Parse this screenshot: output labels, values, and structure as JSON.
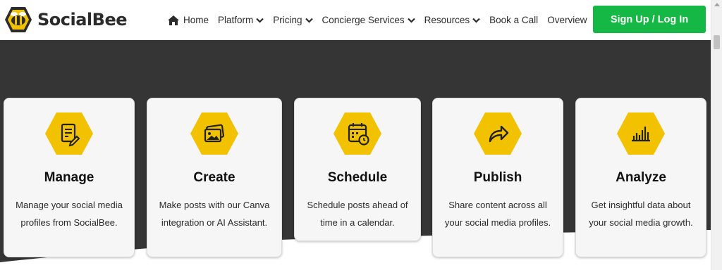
{
  "brand": {
    "name": "SocialBee"
  },
  "nav": {
    "home": "Home",
    "platform": "Platform",
    "pricing": "Pricing",
    "concierge": "Concierge Services",
    "resources": "Resources",
    "book": "Book a Call",
    "overview": "Overview"
  },
  "cta": {
    "signup": "Sign Up / Log In"
  },
  "colors": {
    "accent_green": "#16b845",
    "hex_yellow": "#f2c200",
    "hero_dark": "#353535"
  },
  "cards": [
    {
      "title": "Manage",
      "desc": "Manage your social media profiles from SocialBee.",
      "icon": "document-edit-icon"
    },
    {
      "title": "Create",
      "desc": "Make posts with our Canva integration or AI Assistant.",
      "icon": "images-icon"
    },
    {
      "title": "Schedule",
      "desc": "Schedule posts ahead of time in a calendar.",
      "icon": "calendar-clock-icon"
    },
    {
      "title": "Publish",
      "desc": "Share content across all your social media profiles.",
      "icon": "share-arrow-icon"
    },
    {
      "title": "Analyze",
      "desc": "Get insightful data about your social media growth.",
      "icon": "bar-chart-icon"
    }
  ]
}
